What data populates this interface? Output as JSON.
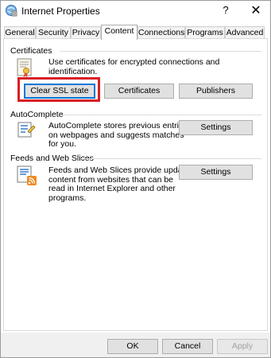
{
  "window": {
    "title": "Internet Properties",
    "help_glyph": "?",
    "close_glyph": "✕"
  },
  "tabs": [
    {
      "label": "General"
    },
    {
      "label": "Security"
    },
    {
      "label": "Privacy"
    },
    {
      "label": "Content",
      "active": true
    },
    {
      "label": "Connections"
    },
    {
      "label": "Programs"
    },
    {
      "label": "Advanced"
    }
  ],
  "certificates": {
    "heading": "Certificates",
    "description": "Use certificates for encrypted connections and identification.",
    "clear_ssl_label": "Clear SSL state",
    "certificates_label": "Certificates",
    "publishers_label": "Publishers"
  },
  "autocomplete": {
    "heading": "AutoComplete",
    "description_lines": [
      "AutoComplete stores previous entries",
      "on webpages and suggests matches",
      "for you."
    ],
    "settings_label": "Settings"
  },
  "feeds": {
    "heading": "Feeds and Web Slices",
    "description_lines": [
      "Feeds and Web Slices provide updated",
      "content from websites that can be",
      "read in Internet Explorer and other",
      "programs."
    ],
    "settings_label": "Settings"
  },
  "footer": {
    "ok_label": "OK",
    "cancel_label": "Cancel",
    "apply_label": "Apply"
  },
  "colors": {
    "highlight": "#d81f26",
    "focus": "#0078d7",
    "button_face": "#e1e1e1"
  },
  "icons": {
    "title": "internet-properties-icon",
    "certificates": "certificate-icon",
    "autocomplete": "autocomplete-form-icon",
    "feeds": "rss-feed-icon"
  }
}
